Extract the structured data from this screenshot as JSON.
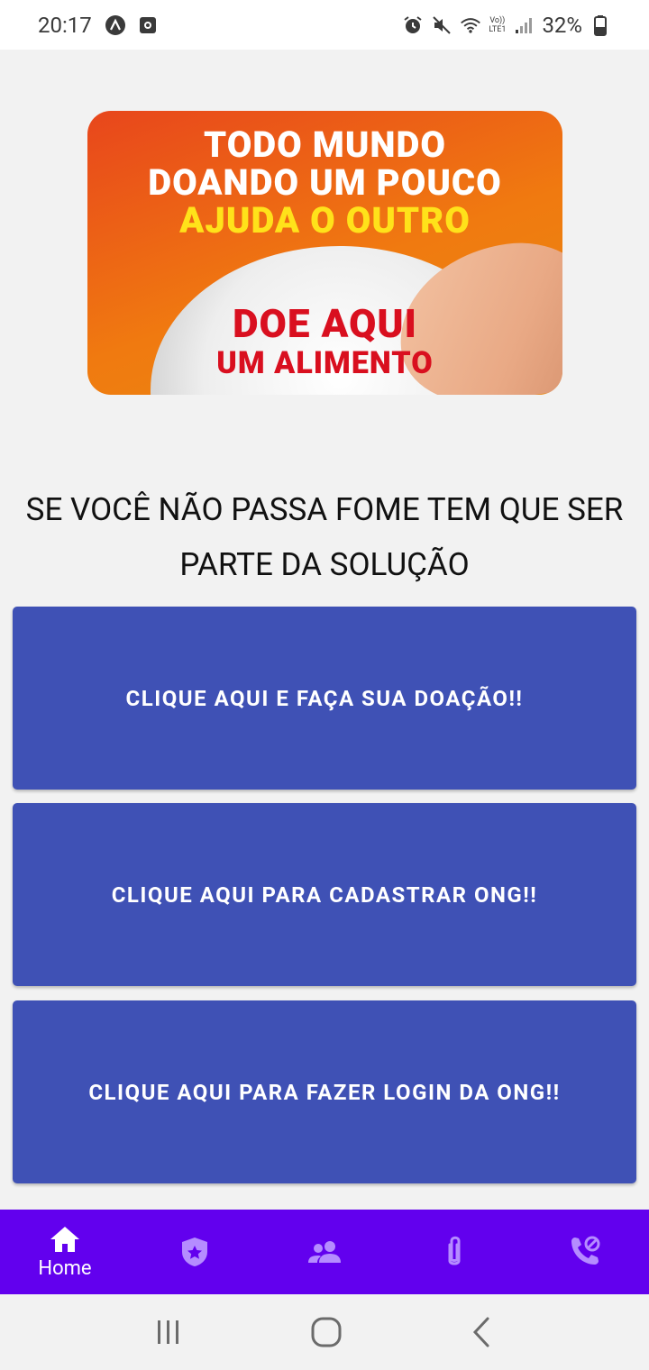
{
  "status_bar": {
    "time": "20:17",
    "battery_percent": "32%",
    "lte_label": "LTE1",
    "volte_label": "Vo))",
    "icons": [
      "app-a-icon",
      "screen-record-icon",
      "alarm-icon",
      "mute-icon",
      "wifi-icon",
      "signal-icon",
      "battery-icon"
    ]
  },
  "banner": {
    "line1": "TODO MUNDO",
    "line2": "DOANDO UM POUCO",
    "line3": "AJUDA O OUTRO",
    "line4": "DOE AQUI",
    "line5": "UM ALIMENTO",
    "colors": {
      "white_text": "#ffffff",
      "yellow_text": "#ffe21a",
      "red_text": "#d90f1f"
    }
  },
  "headline": "SE VOCÊ NÃO PASSA FOME TEM QUE SER PARTE DA SOLUÇÃO",
  "buttons": {
    "donate": "CLIQUE AQUI E FAÇA SUA DOAÇÃO!!",
    "register_ong": "CLIQUE AQUI PARA CADASTRAR ONG!!",
    "login_ong": "CLIQUE AQUI PARA FAZER LOGIN DA ONG!!"
  },
  "bottom_nav": {
    "items": [
      {
        "icon": "home-icon",
        "label": "Home",
        "active": true
      },
      {
        "icon": "badge-star-icon",
        "label": "",
        "active": false
      },
      {
        "icon": "people-icon",
        "label": "",
        "active": false
      },
      {
        "icon": "paperclip-icon",
        "label": "",
        "active": false
      },
      {
        "icon": "phone-blocked-icon",
        "label": "",
        "active": false
      }
    ]
  },
  "colors": {
    "primary_button": "#3f51b5",
    "bottom_nav": "#6200ee",
    "inactive_nav_icon": "#b58cff",
    "background": "#f2f2f2"
  }
}
